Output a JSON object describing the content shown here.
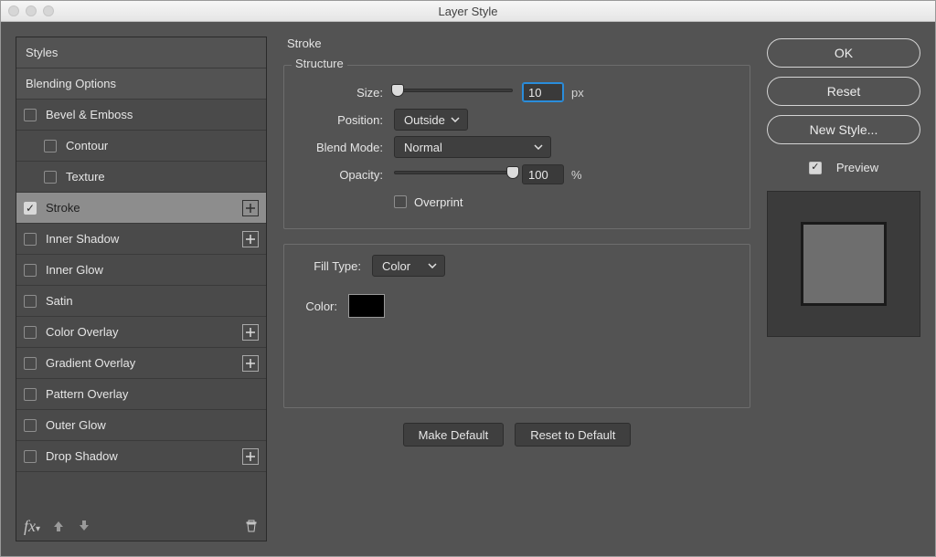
{
  "window": {
    "title": "Layer Style"
  },
  "sidebar": {
    "styles_label": "Styles",
    "blending_label": "Blending Options",
    "items": [
      {
        "label": "Bevel & Emboss",
        "checkable": true,
        "checked": false,
        "plus": false,
        "indent": false
      },
      {
        "label": "Contour",
        "checkable": true,
        "checked": false,
        "plus": false,
        "indent": true
      },
      {
        "label": "Texture",
        "checkable": true,
        "checked": false,
        "plus": false,
        "indent": true
      },
      {
        "label": "Stroke",
        "checkable": true,
        "checked": true,
        "plus": true,
        "indent": false,
        "selected": true
      },
      {
        "label": "Inner Shadow",
        "checkable": true,
        "checked": false,
        "plus": true,
        "indent": false
      },
      {
        "label": "Inner Glow",
        "checkable": true,
        "checked": false,
        "plus": false,
        "indent": false
      },
      {
        "label": "Satin",
        "checkable": true,
        "checked": false,
        "plus": false,
        "indent": false
      },
      {
        "label": "Color Overlay",
        "checkable": true,
        "checked": false,
        "plus": true,
        "indent": false
      },
      {
        "label": "Gradient Overlay",
        "checkable": true,
        "checked": false,
        "plus": true,
        "indent": false
      },
      {
        "label": "Pattern Overlay",
        "checkable": true,
        "checked": false,
        "plus": false,
        "indent": false
      },
      {
        "label": "Outer Glow",
        "checkable": true,
        "checked": false,
        "plus": false,
        "indent": false
      },
      {
        "label": "Drop Shadow",
        "checkable": true,
        "checked": false,
        "plus": true,
        "indent": false
      }
    ]
  },
  "main": {
    "section_title": "Stroke",
    "structure": {
      "legend": "Structure",
      "size_label": "Size:",
      "size_value": "10",
      "size_unit": "px",
      "size_percent": 3,
      "position_label": "Position:",
      "position_value": "Outside",
      "blend_label": "Blend Mode:",
      "blend_value": "Normal",
      "opacity_label": "Opacity:",
      "opacity_value": "100",
      "opacity_unit": "%",
      "opacity_percent": 100,
      "overprint_label": "Overprint",
      "overprint_checked": false
    },
    "fill": {
      "fill_type_label": "Fill Type:",
      "fill_type_value": "Color",
      "color_label": "Color:",
      "color_hex": "#000000"
    },
    "buttons": {
      "make_default": "Make Default",
      "reset_default": "Reset to Default"
    }
  },
  "right": {
    "ok": "OK",
    "reset": "Reset",
    "new_style": "New Style...",
    "preview": "Preview",
    "preview_checked": true
  }
}
